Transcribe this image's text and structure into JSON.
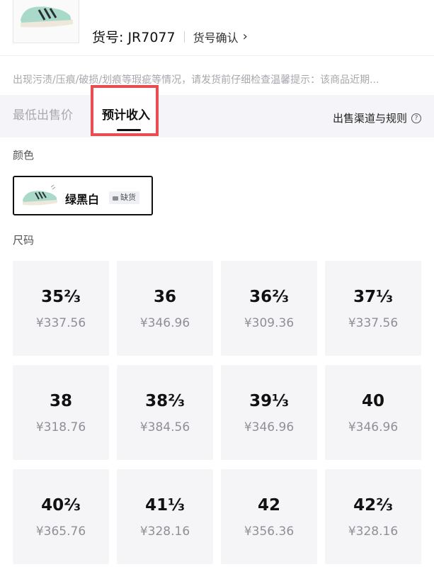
{
  "header": {
    "article_no": "货号: JR7077",
    "confirm": "货号确认",
    "chevron_icon": "chevron-right-icon"
  },
  "notice": {
    "text": "出现污渍/压痕/破损/划痕等瑕疵等情况，请发货前仔细检查温馨提示：该商品近期..."
  },
  "tabs": {
    "lowest_price": "最低出售价",
    "estimated_income": "预计收入",
    "rules": "出售渠道与规则",
    "help_icon": "question-circle-icon",
    "highlight_color": "#ea4d50"
  },
  "color_section": {
    "label": "颜色",
    "option_name": "绿黑白",
    "stock_status": "缺货"
  },
  "size_section": {
    "label": "尺码",
    "sizes": [
      {
        "size": "35⅔",
        "price": "¥337.56"
      },
      {
        "size": "36",
        "price": "¥346.96"
      },
      {
        "size": "36⅔",
        "price": "¥309.36"
      },
      {
        "size": "37⅓",
        "price": "¥337.56"
      },
      {
        "size": "38",
        "price": "¥318.76"
      },
      {
        "size": "38⅔",
        "price": "¥384.56"
      },
      {
        "size": "39⅓",
        "price": "¥346.96"
      },
      {
        "size": "40",
        "price": "¥346.96"
      },
      {
        "size": "40⅔",
        "price": "¥365.76"
      },
      {
        "size": "41⅓",
        "price": "¥328.16"
      },
      {
        "size": "42",
        "price": "¥356.36"
      },
      {
        "size": "42⅔",
        "price": "¥328.16"
      }
    ]
  }
}
